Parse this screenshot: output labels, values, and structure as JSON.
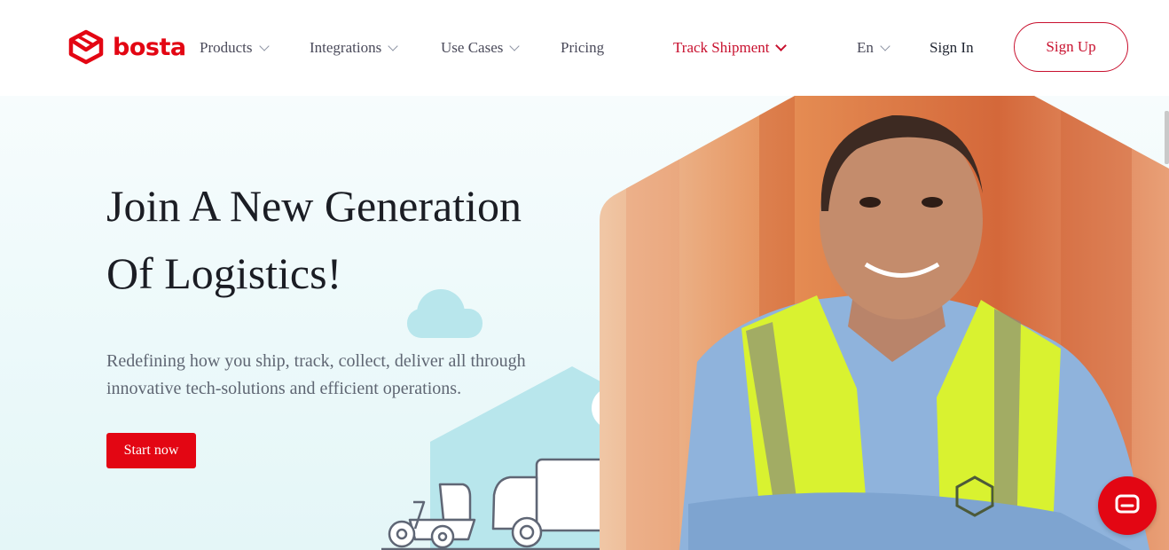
{
  "brand": {
    "name": "bosta",
    "logo_icon": "bosta-box-icon",
    "color": "#e30613"
  },
  "nav": {
    "products": "Products",
    "integrations": "Integrations",
    "use_cases": "Use Cases",
    "pricing": "Pricing",
    "track_shipment": "Track Shipment",
    "language": "En",
    "sign_in": "Sign In",
    "sign_up": "Sign Up"
  },
  "hero": {
    "title_line1": "Join A New Generation",
    "title_line2": "Of Logistics!",
    "subtitle_line1": "Redefining how you ship, track, collect, deliver all through",
    "subtitle_line2": "innovative tech-solutions and efficient operations.",
    "cta": "Start now",
    "image": "smiling-worker-in-safety-vest-photo",
    "illustration": "delivery-truck-and-scooter-illustration"
  },
  "chat": {
    "icon": "chat-bubble-icon"
  },
  "colors": {
    "accent": "#e30613",
    "hero_bg": "#ecf9fa",
    "illustration": "#b8e6ec",
    "vest": "#d9f230"
  }
}
